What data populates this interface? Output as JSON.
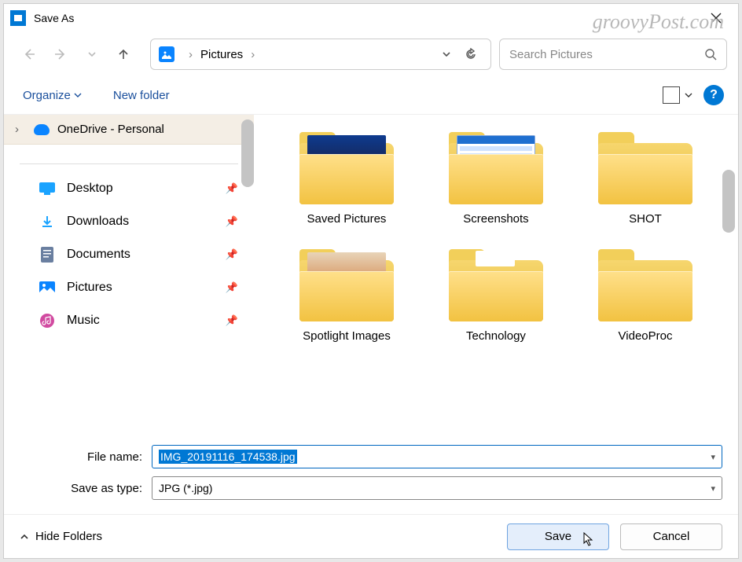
{
  "title": "Save As",
  "watermark": "groovyPost.com",
  "nav": {
    "path_label": "Pictures"
  },
  "search": {
    "placeholder": "Search Pictures"
  },
  "toolbar": {
    "organize": "Organize",
    "new_folder": "New folder"
  },
  "sidebar": {
    "onedrive": "OneDrive - Personal",
    "items": [
      {
        "label": "Desktop",
        "icon": "desktop",
        "color": "#1aa3ff"
      },
      {
        "label": "Downloads",
        "icon": "download",
        "color": "#1aa3ff"
      },
      {
        "label": "Documents",
        "icon": "document",
        "color": "#6a7fa0"
      },
      {
        "label": "Pictures",
        "icon": "pictures",
        "color": "#0a84ff"
      },
      {
        "label": "Music",
        "icon": "music",
        "color": "#d14aa0"
      }
    ]
  },
  "folders": [
    {
      "label": "Saved Pictures",
      "preview": "#0e3b8f"
    },
    {
      "label": "Screenshots",
      "preview": "#cfe2ff"
    },
    {
      "label": "SHOT",
      "preview": null
    },
    {
      "label": "Spotlight Images",
      "preview": "#d07a3a"
    },
    {
      "label": "Technology",
      "preview": "#ffffff"
    },
    {
      "label": "VideoProc",
      "preview": null
    }
  ],
  "fields": {
    "filename_label": "File name:",
    "filename_value": "IMG_20191116_174538.jpg",
    "savetype_label": "Save as type:",
    "savetype_value": "JPG (*.jpg)"
  },
  "footer": {
    "hide_folders": "Hide Folders",
    "save": "Save",
    "cancel": "Cancel"
  }
}
